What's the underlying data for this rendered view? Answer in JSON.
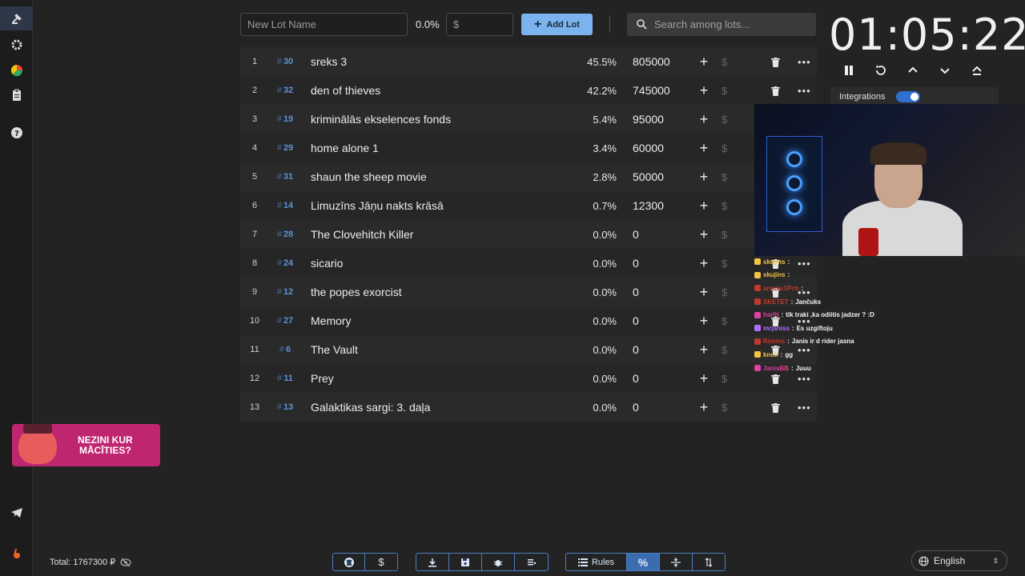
{
  "sidebar": {
    "items": [
      {
        "name": "auction-icon",
        "active": true
      },
      {
        "name": "gear-icon",
        "active": false
      },
      {
        "name": "pie-chart-icon",
        "active": false
      },
      {
        "name": "clipboard-icon",
        "active": false
      },
      {
        "name": "help-icon",
        "active": false
      },
      {
        "name": "telegram-icon",
        "active": false
      },
      {
        "name": "boosty-icon",
        "active": false
      }
    ]
  },
  "toolbar": {
    "lot_name_placeholder": "New Lot Name",
    "percent": "0.0%",
    "amount_placeholder": "$",
    "add_lot_label": "Add Lot",
    "search_placeholder": "Search among lots..."
  },
  "lots": [
    {
      "index": "1",
      "id": "30",
      "name": "sreks 3",
      "percent": "45.5%",
      "amount": "805000"
    },
    {
      "index": "2",
      "id": "32",
      "name": "den of thieves",
      "percent": "42.2%",
      "amount": "745000"
    },
    {
      "index": "3",
      "id": "19",
      "name": "kriminālās ekselences fonds",
      "percent": "5.4%",
      "amount": "95000"
    },
    {
      "index": "4",
      "id": "29",
      "name": "home alone 1",
      "percent": "3.4%",
      "amount": "60000"
    },
    {
      "index": "5",
      "id": "31",
      "name": "shaun the sheep movie",
      "percent": "2.8%",
      "amount": "50000"
    },
    {
      "index": "6",
      "id": "14",
      "name": "Limuzīns Jāņu nakts krāsā",
      "percent": "0.7%",
      "amount": "12300"
    },
    {
      "index": "7",
      "id": "28",
      "name": "The Clovehitch Killer",
      "percent": "0.0%",
      "amount": "0"
    },
    {
      "index": "8",
      "id": "24",
      "name": "sicario",
      "percent": "0.0%",
      "amount": "0"
    },
    {
      "index": "9",
      "id": "12",
      "name": "the popes exorcist",
      "percent": "0.0%",
      "amount": "0"
    },
    {
      "index": "10",
      "id": "27",
      "name": "Memory",
      "percent": "0.0%",
      "amount": "0"
    },
    {
      "index": "11",
      "id": "6",
      "name": "The Vault",
      "percent": "0.0%",
      "amount": "0"
    },
    {
      "index": "12",
      "id": "11",
      "name": "Prey",
      "percent": "0.0%",
      "amount": "0"
    },
    {
      "index": "13",
      "id": "13",
      "name": "Galaktikas sargi: 3. daļa",
      "percent": "0.0%",
      "amount": "0"
    }
  ],
  "timer": {
    "value": "01:05:22",
    "controls": [
      "pause-icon",
      "restart-icon",
      "chevron-up-icon",
      "chevron-down-icon",
      "eject-icon"
    ]
  },
  "integrations": {
    "label": "Integrations",
    "enabled": true
  },
  "chat": [
    {
      "user": "skujins",
      "message": "",
      "color": "#f5c542"
    },
    {
      "user": "skujins",
      "message": "",
      "color": "#f5c542"
    },
    {
      "user": "arasks1Pch",
      "message": "",
      "color": "#c0392b"
    },
    {
      "user": "SKETET",
      "message": "Jančuks",
      "color": "#c0392b"
    },
    {
      "user": "harlit",
      "message": "tik traki ,ka odiitis jadzer ? :D",
      "color": "#e040a0"
    },
    {
      "user": "mrjaniss",
      "message": "Es uzgiftoju",
      "color": "#b070ff"
    },
    {
      "user": "Rimmo",
      "message": "Janis ir d rider jasna",
      "color": "#c0392b"
    },
    {
      "user": "knoll",
      "message": "gg",
      "color": "#f5c542"
    },
    {
      "user": "JanisBB",
      "message": "Juuu",
      "color": "#e040a0"
    }
  ],
  "promo": {
    "text_line1": "NEZINI KUR",
    "text_line2": "MĀCĪTIES?"
  },
  "footer": {
    "total": "Total: 1767300 ₽",
    "group1": [
      "github-icon",
      "dollar-icon"
    ],
    "group2": [
      "download-icon",
      "save-icon",
      "bug-icon",
      "clear-list-icon"
    ],
    "rules_label": "Rules",
    "language": "English"
  }
}
